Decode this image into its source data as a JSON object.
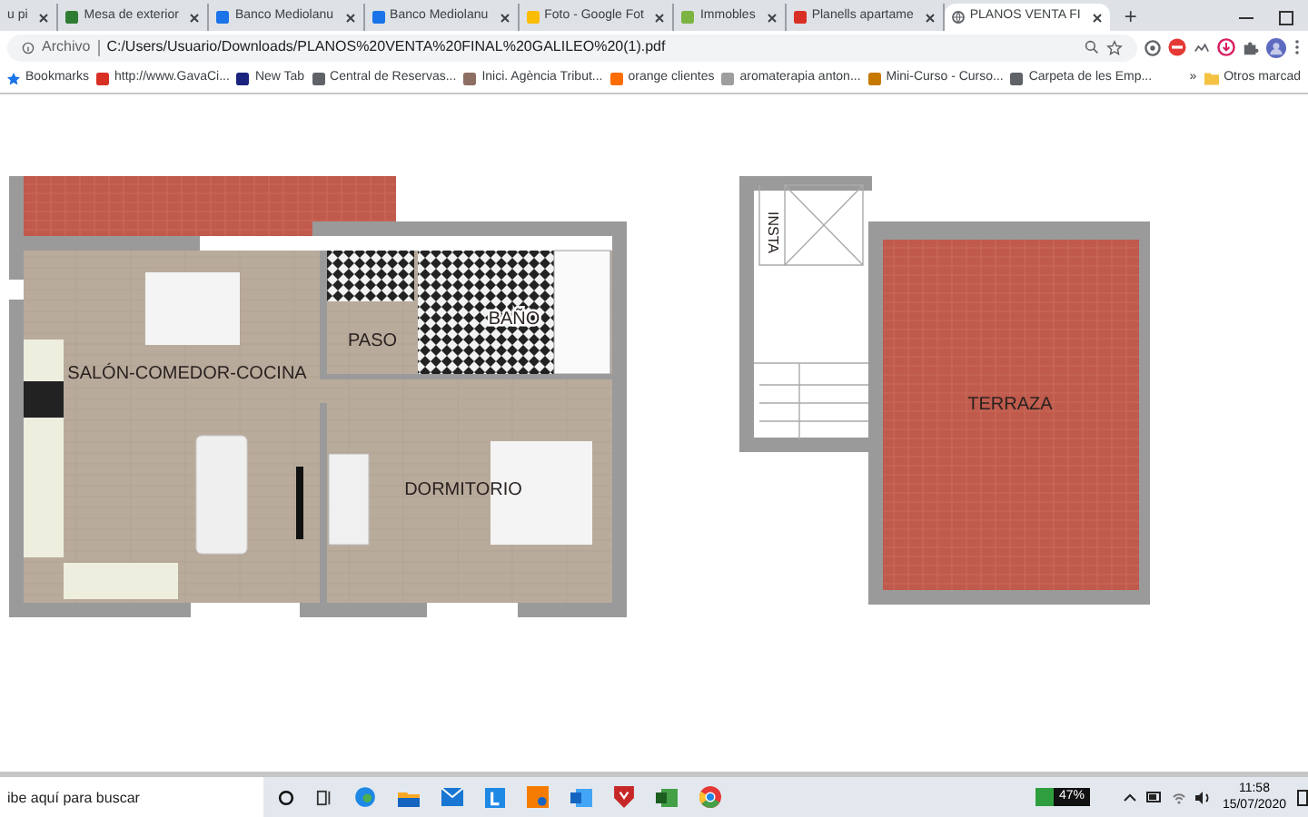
{
  "tabs": [
    {
      "label": "u pi",
      "selected": false
    },
    {
      "label": "Mesa de exterior",
      "selected": false
    },
    {
      "label": "Banco Mediolanu",
      "selected": false
    },
    {
      "label": "Banco Mediolanu",
      "selected": false
    },
    {
      "label": "Foto - Google Fot",
      "selected": false
    },
    {
      "label": "Immobles",
      "selected": false
    },
    {
      "label": "Planells apartame",
      "selected": false
    },
    {
      "label": "PLANOS VENTA FI",
      "selected": true
    }
  ],
  "new_tab": "+",
  "address_bar": {
    "scheme": "Archivo",
    "url": "C:/Users/Usuario/Downloads/PLANOS%20VENTA%20FINAL%20GALILEO%20(1).pdf"
  },
  "bookmarks": [
    {
      "label": "Bookmarks"
    },
    {
      "label": "http://www.GavaCi..."
    },
    {
      "label": "New Tab"
    },
    {
      "label": "Central de Reservas..."
    },
    {
      "label": "Inici. Agència Tribut..."
    },
    {
      "label": "orange clientes"
    },
    {
      "label": "aromaterapia anton..."
    },
    {
      "label": "Mini-Curso - Curso..."
    },
    {
      "label": "Carpeta de les Emp..."
    }
  ],
  "bookmarks_overflow": "»",
  "other_bookmarks": "Otros marcad",
  "floor_plan": {
    "rooms": [
      {
        "label": "SALÓN-COMEDOR-COCINA"
      },
      {
        "label": "PASO"
      },
      {
        "label": "BAÑO"
      },
      {
        "label": "DORMITORIO"
      },
      {
        "label": "INSTA"
      },
      {
        "label": "TERRAZA"
      }
    ]
  },
  "taskbar": {
    "search": {
      "placeholder": "ibe aquí para buscar"
    },
    "battery": "47%",
    "time": "11:58",
    "date": "15/07/2020"
  }
}
